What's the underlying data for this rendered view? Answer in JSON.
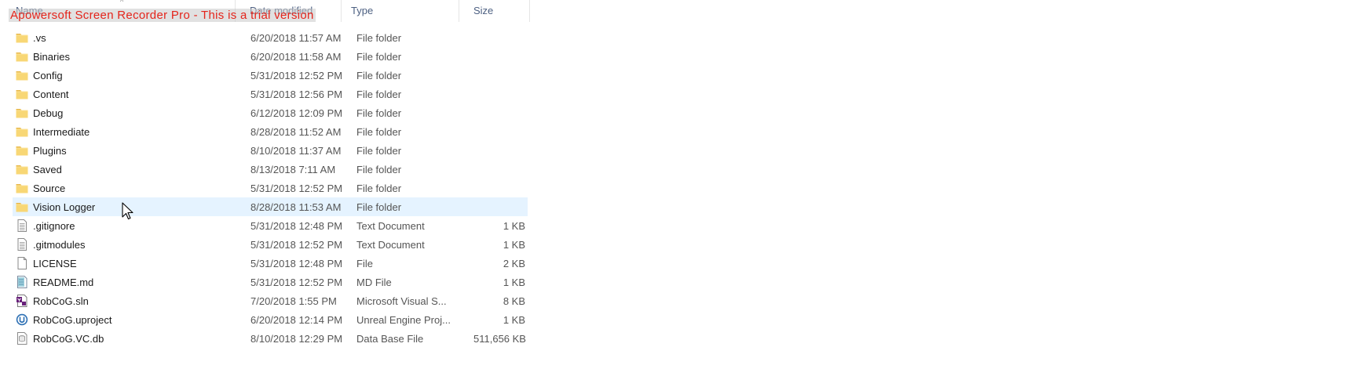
{
  "watermark": "Apowersoft Screen Recorder Pro - This is a trial version",
  "columns": {
    "name": "Name",
    "date_modified": "Date modified",
    "type": "Type",
    "size": "Size"
  },
  "files": [
    {
      "name": ".vs",
      "date": "6/20/2018 11:57 AM",
      "type": "File folder",
      "size": "",
      "icon": "folder-icon"
    },
    {
      "name": "Binaries",
      "date": "6/20/2018 11:58 AM",
      "type": "File folder",
      "size": "",
      "icon": "folder-icon"
    },
    {
      "name": "Config",
      "date": "5/31/2018 12:52 PM",
      "type": "File folder",
      "size": "",
      "icon": "folder-icon"
    },
    {
      "name": "Content",
      "date": "5/31/2018 12:56 PM",
      "type": "File folder",
      "size": "",
      "icon": "folder-icon"
    },
    {
      "name": "Debug",
      "date": "6/12/2018 12:09 PM",
      "type": "File folder",
      "size": "",
      "icon": "folder-icon"
    },
    {
      "name": "Intermediate",
      "date": "8/28/2018 11:52 AM",
      "type": "File folder",
      "size": "",
      "icon": "folder-icon"
    },
    {
      "name": "Plugins",
      "date": "8/10/2018 11:37 AM",
      "type": "File folder",
      "size": "",
      "icon": "folder-icon"
    },
    {
      "name": "Saved",
      "date": "8/13/2018 7:11 AM",
      "type": "File folder",
      "size": "",
      "icon": "folder-icon"
    },
    {
      "name": "Source",
      "date": "5/31/2018 12:52 PM",
      "type": "File folder",
      "size": "",
      "icon": "folder-icon"
    },
    {
      "name": "Vision Logger",
      "date": "8/28/2018 11:53 AM",
      "type": "File folder",
      "size": "",
      "icon": "folder-icon",
      "hover": true
    },
    {
      "name": ".gitignore",
      "date": "5/31/2018 12:48 PM",
      "type": "Text Document",
      "size": "1 KB",
      "icon": "text-document-icon"
    },
    {
      "name": ".gitmodules",
      "date": "5/31/2018 12:52 PM",
      "type": "Text Document",
      "size": "1 KB",
      "icon": "text-document-icon"
    },
    {
      "name": "LICENSE",
      "date": "5/31/2018 12:48 PM",
      "type": "File",
      "size": "2 KB",
      "icon": "blank-file-icon"
    },
    {
      "name": "README.md",
      "date": "5/31/2018 12:52 PM",
      "type": "MD File",
      "size": "1 KB",
      "icon": "markdown-file-icon"
    },
    {
      "name": "RobCoG.sln",
      "date": "7/20/2018 1:55 PM",
      "type": "Microsoft Visual S...",
      "size": "8 KB",
      "icon": "visual-studio-solution-icon"
    },
    {
      "name": "RobCoG.uproject",
      "date": "6/20/2018 12:14 PM",
      "type": "Unreal Engine Proj...",
      "size": "1 KB",
      "icon": "unreal-engine-icon"
    },
    {
      "name": "RobCoG.VC.db",
      "date": "8/10/2018 12:29 PM",
      "type": "Data Base File",
      "size": "511,656 KB",
      "icon": "database-file-icon"
    }
  ],
  "colors": {
    "folder": "#f8d775",
    "hover_row": "#e5f3ff",
    "watermark_text": "#e4241b",
    "header_text": "#4d6082"
  }
}
